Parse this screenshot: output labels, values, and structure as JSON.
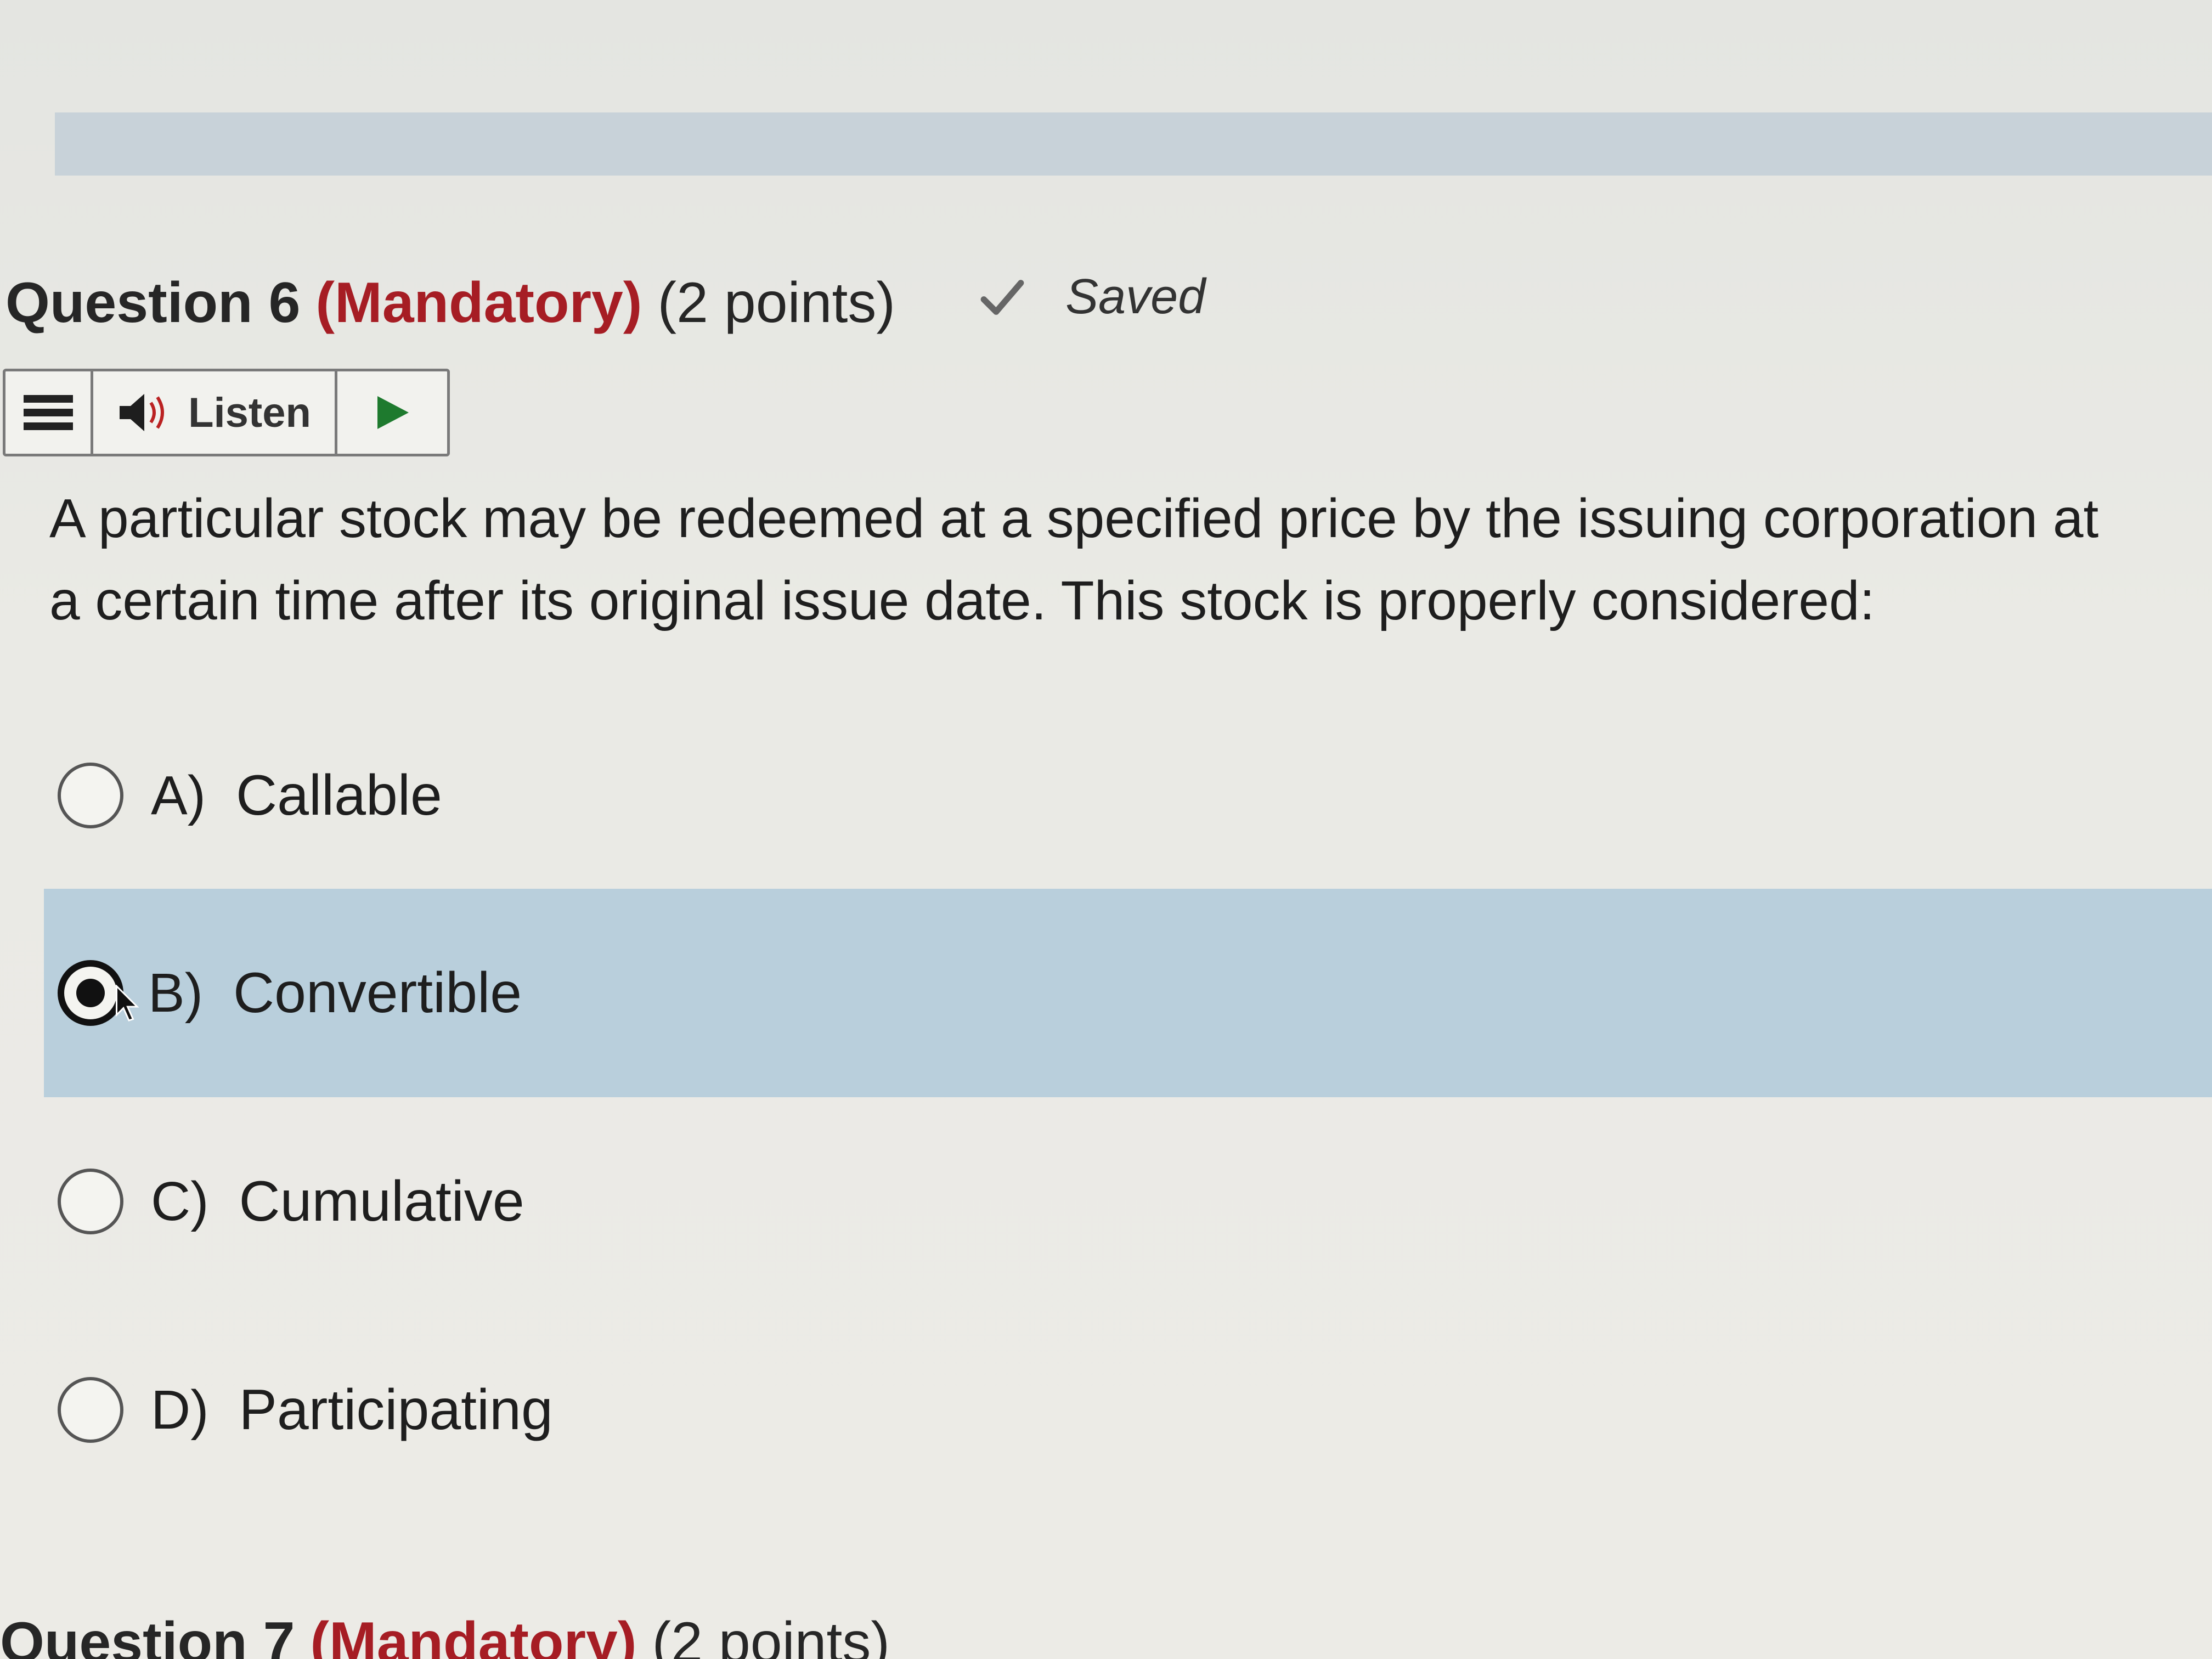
{
  "question": {
    "title": "Question 6",
    "mandatory": "(Mandatory)",
    "points": "(2 points)",
    "status": "Saved",
    "text": "A particular stock may be redeemed at a specified price by the issuing corporation at\na certain time after its original issue date. This stock is properly considered:"
  },
  "toolbar": {
    "menu_icon": "menu-icon",
    "speaker_icon": "speaker-icon",
    "listen_label": "Listen",
    "play_icon": "play-icon"
  },
  "options": [
    {
      "letter": "A)",
      "text": "Callable",
      "selected": false
    },
    {
      "letter": "B)",
      "text": "Convertible",
      "selected": true
    },
    {
      "letter": "C)",
      "text": "Cumulative",
      "selected": false
    },
    {
      "letter": "D)",
      "text": "Participating",
      "selected": false
    }
  ],
  "next_question": {
    "title": "Question 7",
    "mandatory": "(Mandatory)",
    "points": "(2 points)"
  },
  "colors": {
    "mandatory": "#a61d24",
    "selected_row": "#b9cfdc",
    "play": "#1e7a2e"
  }
}
